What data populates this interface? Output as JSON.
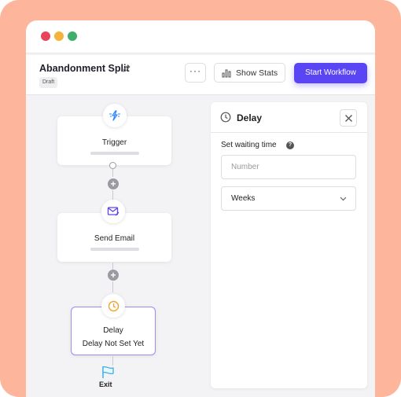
{
  "window": {
    "controls": [
      "close",
      "minimize",
      "maximize"
    ]
  },
  "header": {
    "workflow_title": "Abandonment Split",
    "status_badge": "Draft",
    "more_label": "···",
    "show_stats_label": "Show Stats",
    "start_label": "Start Workflow"
  },
  "canvas": {
    "nodes": [
      {
        "label": "Trigger",
        "icon": "lightning-icon"
      },
      {
        "label": "Send Email",
        "icon": "email-icon"
      },
      {
        "label": "Delay",
        "sub": "Delay Not Set Yet",
        "icon": "clock-icon"
      }
    ],
    "add_symbol": "+",
    "exit_label": "Exit"
  },
  "panel": {
    "title": "Delay",
    "field_label": "Set waiting time",
    "help_symbol": "?",
    "number_placeholder": "Number",
    "unit_value": "Weeks"
  },
  "colors": {
    "background": "#fdb59b",
    "accent": "#5a45f5",
    "delay_border": "#9a8cf4",
    "trigger_icon": "#2f88ff",
    "email_icon": "#5a45f5",
    "clock_icon": "#f0a531",
    "exit_flag": "#3ab0e6"
  }
}
